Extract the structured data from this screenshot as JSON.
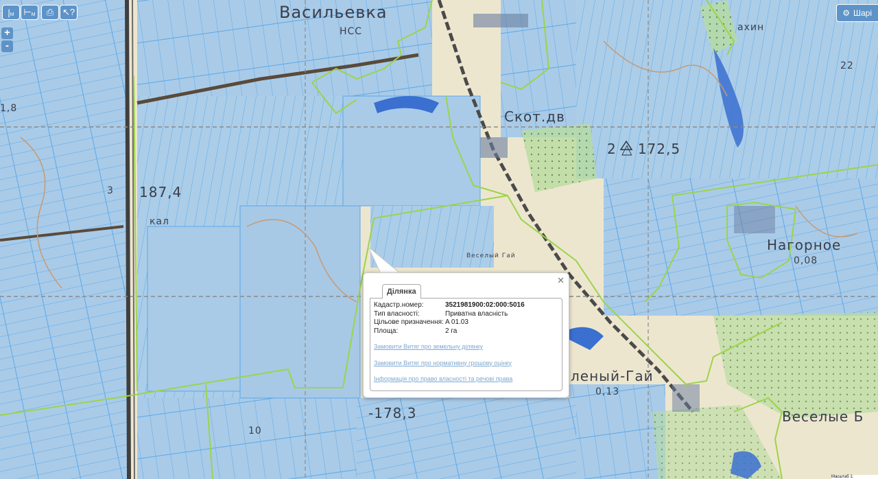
{
  "toolbar": {
    "ruler_label": "М",
    "area_label": "М",
    "print_icon": "printer-icon",
    "identify_icon": "cursor-question-icon"
  },
  "zoom": {
    "in_label": "+",
    "out_label": "-"
  },
  "share": {
    "label": "Шарі",
    "icon": "gear-icon"
  },
  "map": {
    "labels": [
      {
        "text": "Васильевка",
        "style": "big"
      },
      {
        "text": "НСС",
        "style": "small"
      },
      {
        "text": "1,8",
        "style": "small"
      },
      {
        "text": "3",
        "style": "small"
      },
      {
        "text": "187,4",
        "style": "mid"
      },
      {
        "text": "кал",
        "style": "small"
      },
      {
        "text": "Скот.дв",
        "style": "mid"
      },
      {
        "text": "2 △ 172,5",
        "style": "mid"
      },
      {
        "text": "Нагорное",
        "style": "mid"
      },
      {
        "text": "0,08",
        "style": "small"
      },
      {
        "text": "-178,3",
        "style": "mid"
      },
      {
        "text": "10",
        "style": "small"
      },
      {
        "text": "леный-Гай",
        "style": "mid"
      },
      {
        "text": "0,13",
        "style": "small"
      },
      {
        "text": "Веселые Б",
        "style": "mid"
      },
      {
        "text": "ахин",
        "style": "small"
      },
      {
        "text": "22",
        "style": "small"
      },
      {
        "text": "Веселый Гай",
        "style": "small"
      }
    ],
    "colors": {
      "parcel_fill": "#a9cbe8",
      "parcel_line": "#5aa7e8",
      "boundary": "#9bd44a",
      "forest": "#b8dca0",
      "water": "#3b6fd0",
      "road": "#4a4a4a"
    }
  },
  "popup": {
    "tab_label": "Ділянка",
    "close_symbol": "✕",
    "fields": [
      {
        "key": "Кадастр.номер:",
        "value": "3521981900:02:000:5016"
      },
      {
        "key": "Тип власності:",
        "value": "Приватна власність"
      },
      {
        "key": "Цільове призначення:",
        "value": "A 01.03"
      },
      {
        "key": "Площа:",
        "value": "2 га"
      }
    ],
    "links": [
      "Замовити Витяг про земельну ділянку",
      "Замовити Витяг про нормативну грошову оцінку",
      "Інформація про право власності та речові права"
    ]
  },
  "scale": {
    "label": "Масштаб 1:"
  }
}
